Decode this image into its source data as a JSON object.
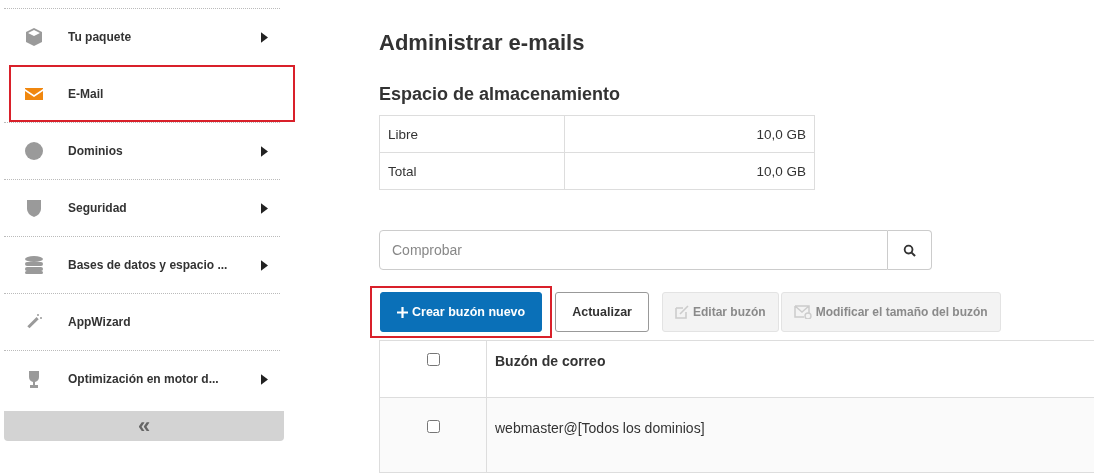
{
  "sidebar": {
    "items": [
      {
        "label": "Tu paquete",
        "selected": false,
        "highlighted": false,
        "has_submenu": true
      },
      {
        "label": "E-Mail",
        "selected": true,
        "highlighted": true,
        "has_submenu": false
      },
      {
        "label": "Dominios",
        "selected": false,
        "highlighted": false,
        "has_submenu": true
      },
      {
        "label": "Seguridad",
        "selected": false,
        "highlighted": false,
        "has_submenu": true
      },
      {
        "label": "Bases de datos y espacio ...",
        "selected": false,
        "highlighted": false,
        "has_submenu": true
      },
      {
        "label": "AppWizard",
        "selected": false,
        "highlighted": false,
        "has_submenu": false
      },
      {
        "label": "Optimización en motor d...",
        "selected": false,
        "highlighted": false,
        "has_submenu": true
      }
    ],
    "collapse": "«"
  },
  "title": "Administrar e-mails",
  "storage": {
    "title": "Espacio de almacenamiento",
    "rows": [
      {
        "label": "Libre",
        "value": "10,0 GB"
      },
      {
        "label": "Total",
        "value": "10,0 GB"
      }
    ]
  },
  "search": {
    "placeholder": "Comprobar"
  },
  "buttons": [
    {
      "label": "Crear buzón nuevo",
      "kind": "primary",
      "highlighted": true,
      "disabled": false
    },
    {
      "label": "Actualizar",
      "kind": "default",
      "highlighted": false,
      "disabled": false
    },
    {
      "label": "Editar buzón",
      "kind": "edit",
      "highlighted": false,
      "disabled": true
    },
    {
      "label": "Modificar el tamaño del buzón",
      "kind": "resize",
      "highlighted": false,
      "disabled": true
    }
  ],
  "table": {
    "header": {
      "label": "Buzón de correo",
      "checked": false
    },
    "rows": [
      {
        "label": "webmaster@[Todos los dominios]",
        "checked": false
      }
    ]
  }
}
